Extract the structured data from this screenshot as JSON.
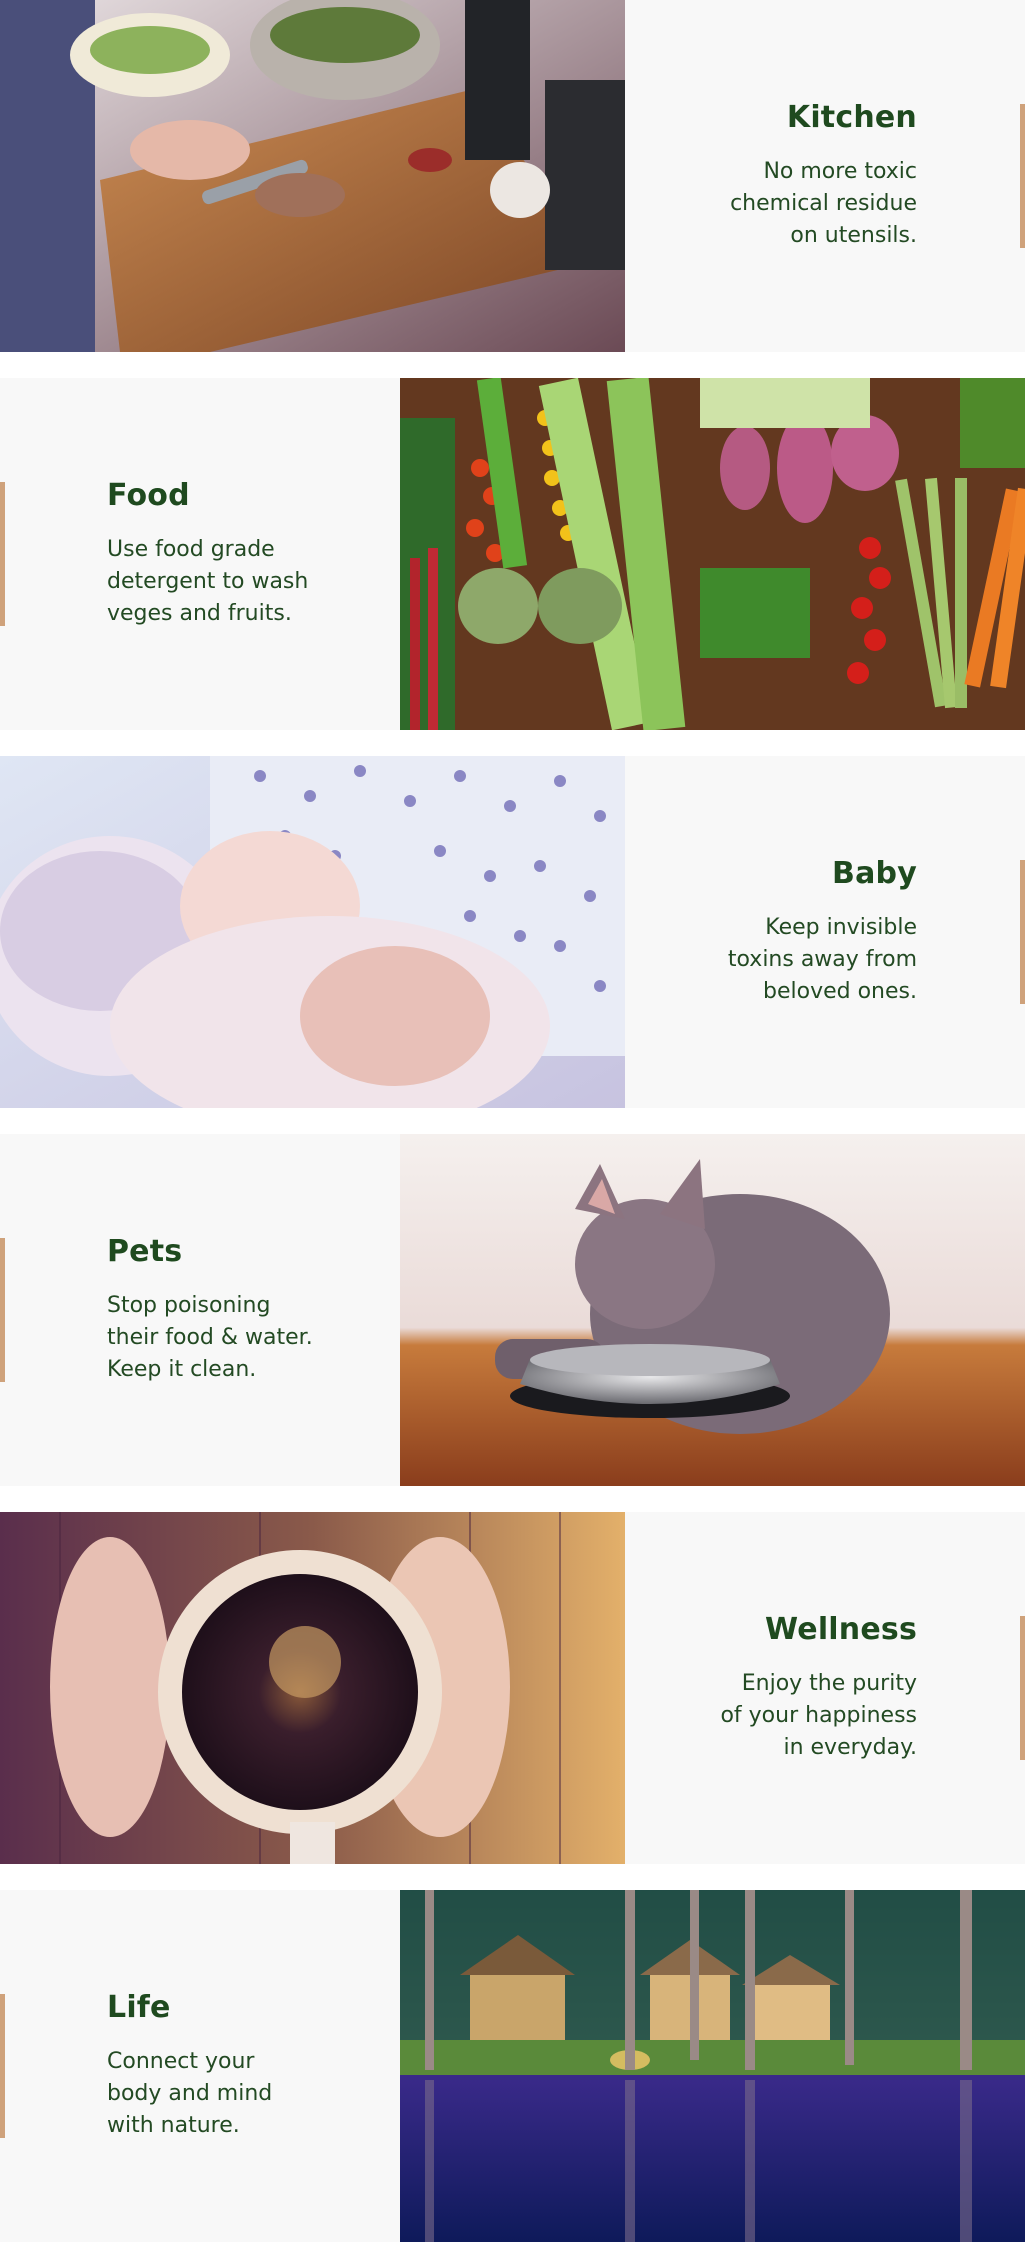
{
  "sections": [
    {
      "title": "Kitchen",
      "description": "No more toxic\nchemical residue\non utensils.",
      "image": "kitchen-cutting-board-photo"
    },
    {
      "title": "Food",
      "description": "Use food grade\ndetergent to wash\nveges and fruits.",
      "image": "vegetables-photo"
    },
    {
      "title": "Baby",
      "description": "Keep invisible\ntoxins away from\nbeloved ones.",
      "image": "sleeping-baby-photo"
    },
    {
      "title": "Pets",
      "description": "Stop poisoning\ntheir food & water.\nKeep it clean.",
      "image": "cat-eating-photo"
    },
    {
      "title": "Wellness",
      "description": "Enjoy the purity\nof your happiness\nin everyday.",
      "image": "coffee-cup-photo"
    },
    {
      "title": "Life",
      "description": "Connect your\nbody and mind\nwith nature.",
      "image": "lakeside-cabins-photo"
    }
  ],
  "colors": {
    "heading": "#1f4a1f",
    "accent_bar": "#cfa27b",
    "panel_background": "#f8f8f8"
  }
}
